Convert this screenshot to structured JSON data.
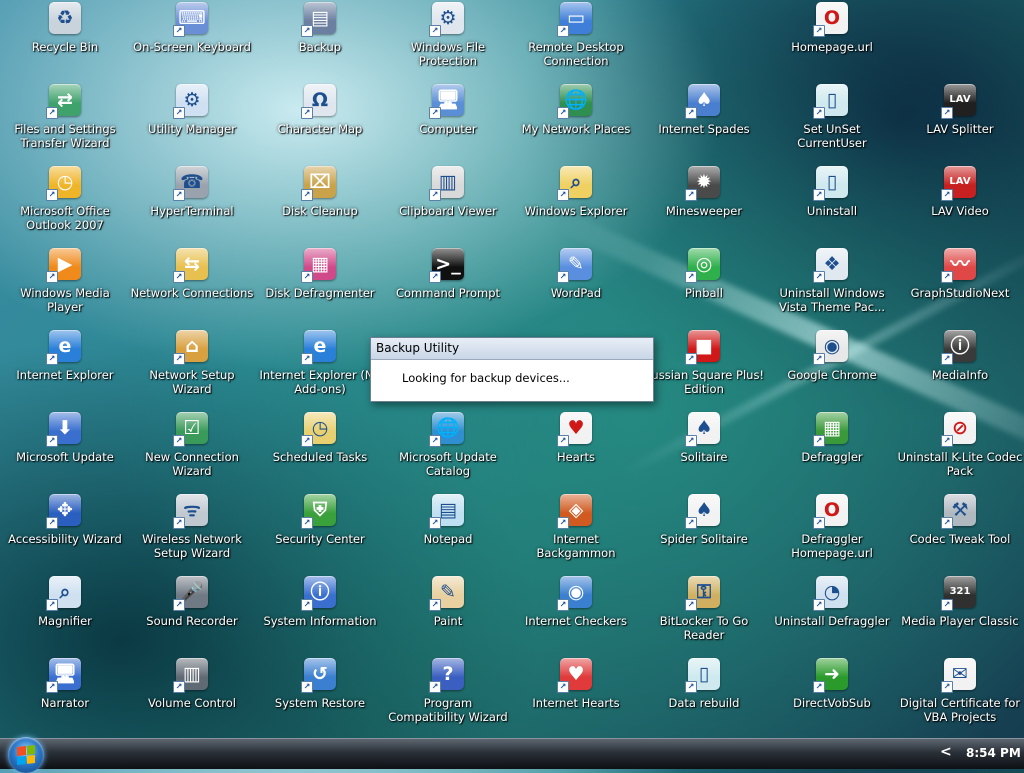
{
  "desktop": {
    "icons": [
      {
        "label": "Recycle Bin",
        "name": "recycle-bin-icon",
        "color": "#c9d3dc",
        "glyph": "♻"
      },
      {
        "label": "On-Screen Keyboard",
        "name": "keyboard-icon",
        "color": "#6b8fd6",
        "glyph": "⌨"
      },
      {
        "label": "Backup",
        "name": "backup-icon",
        "color": "#6b7fa0",
        "glyph": "▤"
      },
      {
        "label": "Windows File Protection",
        "name": "file-protection-icon",
        "color": "#dfe6ee",
        "glyph": "⚙"
      },
      {
        "label": "Remote Desktop Connection",
        "name": "remote-desktop-icon",
        "color": "#3f7fd9",
        "glyph": "▭"
      },
      {
        "label": "",
        "name": "",
        "color": "",
        "glyph": ""
      },
      {
        "label": "Homepage.url",
        "name": "homepage-url-icon",
        "color": "#f2f2f2",
        "glyph": "O"
      },
      {
        "label": "",
        "name": "",
        "color": "",
        "glyph": ""
      },
      {
        "label": "Files and Settings Transfer Wizard",
        "name": "transfer-wizard-icon",
        "color": "#3fa26b",
        "glyph": "⇄"
      },
      {
        "label": "Utility Manager",
        "name": "utility-manager-icon",
        "color": "#cfe0f2",
        "glyph": "⚙"
      },
      {
        "label": "Character Map",
        "name": "character-map-icon",
        "color": "#dfe6ee",
        "glyph": "Ω"
      },
      {
        "label": "Computer",
        "name": "computer-icon",
        "color": "#5a8fd6",
        "glyph": "🖥"
      },
      {
        "label": "My Network Places",
        "name": "network-places-icon",
        "color": "#2f8f4f",
        "glyph": "🌐"
      },
      {
        "label": "Internet Spades",
        "name": "internet-spades-icon",
        "color": "#4a7fd0",
        "glyph": "♠"
      },
      {
        "label": "Set UnSet CurrentUser",
        "name": "set-unset-user-icon",
        "color": "#cfe9ee",
        "glyph": "▯"
      },
      {
        "label": "LAV Splitter",
        "name": "lav-splitter-icon",
        "color": "#202020",
        "glyph": "LAV"
      },
      {
        "label": "Microsoft Office Outlook 2007",
        "name": "outlook-icon",
        "color": "#f0b428",
        "glyph": "◷"
      },
      {
        "label": "HyperTerminal",
        "name": "hyperterminal-icon",
        "color": "#9aa3ad",
        "glyph": "☎"
      },
      {
        "label": "Disk Cleanup",
        "name": "disk-cleanup-icon",
        "color": "#c9a24a",
        "glyph": "⌧"
      },
      {
        "label": "Clipboard Viewer",
        "name": "clipboard-viewer-icon",
        "color": "#d9d9d9",
        "glyph": "▥"
      },
      {
        "label": "Windows Explorer",
        "name": "windows-explorer-icon",
        "color": "#f0d060",
        "glyph": "⌕"
      },
      {
        "label": "Minesweeper",
        "name": "minesweeper-icon",
        "color": "#4a4a4a",
        "glyph": "✹"
      },
      {
        "label": "Uninstall",
        "name": "uninstall-icon",
        "color": "#cfe9ee",
        "glyph": "▯"
      },
      {
        "label": "LAV Video",
        "name": "lav-video-icon",
        "color": "#c62020",
        "glyph": "LAV"
      },
      {
        "label": "Windows Media Player",
        "name": "media-player-icon",
        "color": "#f08a1a",
        "glyph": "▶"
      },
      {
        "label": "Network Connections",
        "name": "network-connections-icon",
        "color": "#e8c050",
        "glyph": "⇆"
      },
      {
        "label": "Disk Defragmenter",
        "name": "disk-defragmenter-icon",
        "color": "#d04a8a",
        "glyph": "▦"
      },
      {
        "label": "Command Prompt",
        "name": "command-prompt-icon",
        "color": "#101010",
        "glyph": ">_"
      },
      {
        "label": "WordPad",
        "name": "wordpad-icon",
        "color": "#5a8fe0",
        "glyph": "✎"
      },
      {
        "label": "Pinball",
        "name": "pinball-icon",
        "color": "#2fb04a",
        "glyph": "◎"
      },
      {
        "label": "Uninstall Windows Vista Theme Pac...",
        "name": "vista-theme-icon",
        "color": "#e0e8f0",
        "glyph": "❖"
      },
      {
        "label": "GraphStudioNext",
        "name": "graphstudio-icon",
        "color": "#e04848",
        "glyph": "〰"
      },
      {
        "label": "Internet Explorer",
        "name": "internet-explorer-icon",
        "color": "#2a7fd9",
        "glyph": "e"
      },
      {
        "label": "Network Setup Wizard",
        "name": "network-setup-wizard-icon",
        "color": "#d9a040",
        "glyph": "⌂"
      },
      {
        "label": "Internet Explorer (No Add-ons)",
        "name": "ie-no-addons-icon",
        "color": "#2a7fd9",
        "glyph": "e"
      },
      {
        "label": "",
        "name": "",
        "color": "",
        "glyph": ""
      },
      {
        "label": "",
        "name": "",
        "color": "",
        "glyph": ""
      },
      {
        "label": "Russian Square Plus! Edition",
        "name": "russian-square-icon",
        "color": "#d01818",
        "glyph": "■"
      },
      {
        "label": "Google Chrome",
        "name": "google-chrome-icon",
        "color": "#e8e8e8",
        "glyph": "◉"
      },
      {
        "label": "MediaInfo",
        "name": "mediainfo-icon",
        "color": "#3a3a3a",
        "glyph": "ⓘ"
      },
      {
        "label": "Microsoft Update",
        "name": "microsoft-update-icon",
        "color": "#3a6fd0",
        "glyph": "⬇"
      },
      {
        "label": "New Connection Wizard",
        "name": "new-connection-wizard-icon",
        "color": "#3a9a5a",
        "glyph": "☑"
      },
      {
        "label": "Scheduled Tasks",
        "name": "scheduled-tasks-icon",
        "color": "#e8d070",
        "glyph": "◷"
      },
      {
        "label": "Microsoft Update Catalog",
        "name": "update-catalog-icon",
        "color": "#2f8fd0",
        "glyph": "🌐"
      },
      {
        "label": "Hearts",
        "name": "hearts-icon",
        "color": "#f2f2f2",
        "glyph": "♥"
      },
      {
        "label": "Solitaire",
        "name": "solitaire-icon",
        "color": "#f2f2f2",
        "glyph": "♠"
      },
      {
        "label": "Defraggler",
        "name": "defraggler-icon",
        "color": "#3a9a3a",
        "glyph": "▦"
      },
      {
        "label": "Uninstall K-Lite Codec Pack",
        "name": "uninstall-klite-icon",
        "color": "#f2f2f2",
        "glyph": "⊘"
      },
      {
        "label": "Accessibility Wizard",
        "name": "accessibility-wizard-icon",
        "color": "#2a5fc0",
        "glyph": "✥"
      },
      {
        "label": "Wireless Network Setup Wizard",
        "name": "wireless-setup-icon",
        "color": "#c0c8d0",
        "glyph": "ᯤ"
      },
      {
        "label": "Security Center",
        "name": "security-center-icon",
        "color": "#3aa03a",
        "glyph": "⛨"
      },
      {
        "label": "Notepad",
        "name": "notepad-icon",
        "color": "#bfe0f0",
        "glyph": "▤"
      },
      {
        "label": "Internet Backgammon",
        "name": "internet-backgammon-icon",
        "color": "#d05a20",
        "glyph": "◈"
      },
      {
        "label": "Spider Solitaire",
        "name": "spider-solitaire-icon",
        "color": "#f2f2f2",
        "glyph": "♠"
      },
      {
        "label": "Defraggler Homepage.url",
        "name": "defraggler-homepage-icon",
        "color": "#f2f2f2",
        "glyph": "O"
      },
      {
        "label": "Codec Tweak Tool",
        "name": "codec-tweak-icon",
        "color": "#b0b8c0",
        "glyph": "⚒"
      },
      {
        "label": "Magnifier",
        "name": "magnifier-icon",
        "color": "#cfe0f0",
        "glyph": "⌕"
      },
      {
        "label": "Sound Recorder",
        "name": "sound-recorder-icon",
        "color": "#707a84",
        "glyph": "🎤"
      },
      {
        "label": "System Information",
        "name": "system-information-icon",
        "color": "#3a6fd0",
        "glyph": "ⓘ"
      },
      {
        "label": "Paint",
        "name": "paint-icon",
        "color": "#e8d0a0",
        "glyph": "✎"
      },
      {
        "label": "Internet Checkers",
        "name": "internet-checkers-icon",
        "color": "#3a7fd0",
        "glyph": "◉"
      },
      {
        "label": "BitLocker To Go Reader",
        "name": "bitlocker-icon",
        "color": "#d0b060",
        "glyph": "⚿"
      },
      {
        "label": "Uninstall Defraggler",
        "name": "uninstall-defraggler-icon",
        "color": "#cfe0ee",
        "glyph": "◔"
      },
      {
        "label": "Media Player Classic",
        "name": "media-player-classic-icon",
        "color": "#303030",
        "glyph": "321"
      },
      {
        "label": "Narrator",
        "name": "narrator-icon",
        "color": "#3a6fd0",
        "glyph": "🖥"
      },
      {
        "label": "Volume Control",
        "name": "volume-control-icon",
        "color": "#606a74",
        "glyph": "▥"
      },
      {
        "label": "System Restore",
        "name": "system-restore-icon",
        "color": "#3a7fd0",
        "glyph": "↺"
      },
      {
        "label": "Program Compatibility Wizard",
        "name": "compatibility-wizard-icon",
        "color": "#3a5fc0",
        "glyph": "?"
      },
      {
        "label": "Internet Hearts",
        "name": "internet-hearts-icon",
        "color": "#e03a3a",
        "glyph": "♥"
      },
      {
        "label": "Data rebuild",
        "name": "data-rebuild-icon",
        "color": "#cfe9ee",
        "glyph": "▯"
      },
      {
        "label": "DirectVobSub",
        "name": "directvobsub-icon",
        "color": "#2a9a2a",
        "glyph": "➜"
      },
      {
        "label": "Digital Certificate for VBA Projects",
        "name": "digital-certificate-icon",
        "color": "#f2f2f2",
        "glyph": "✉"
      }
    ]
  },
  "dialog": {
    "title": "Backup Utility",
    "message": "Looking for backup devices..."
  },
  "taskbar": {
    "tray_chevron": "<",
    "clock": "8:54 PM"
  }
}
